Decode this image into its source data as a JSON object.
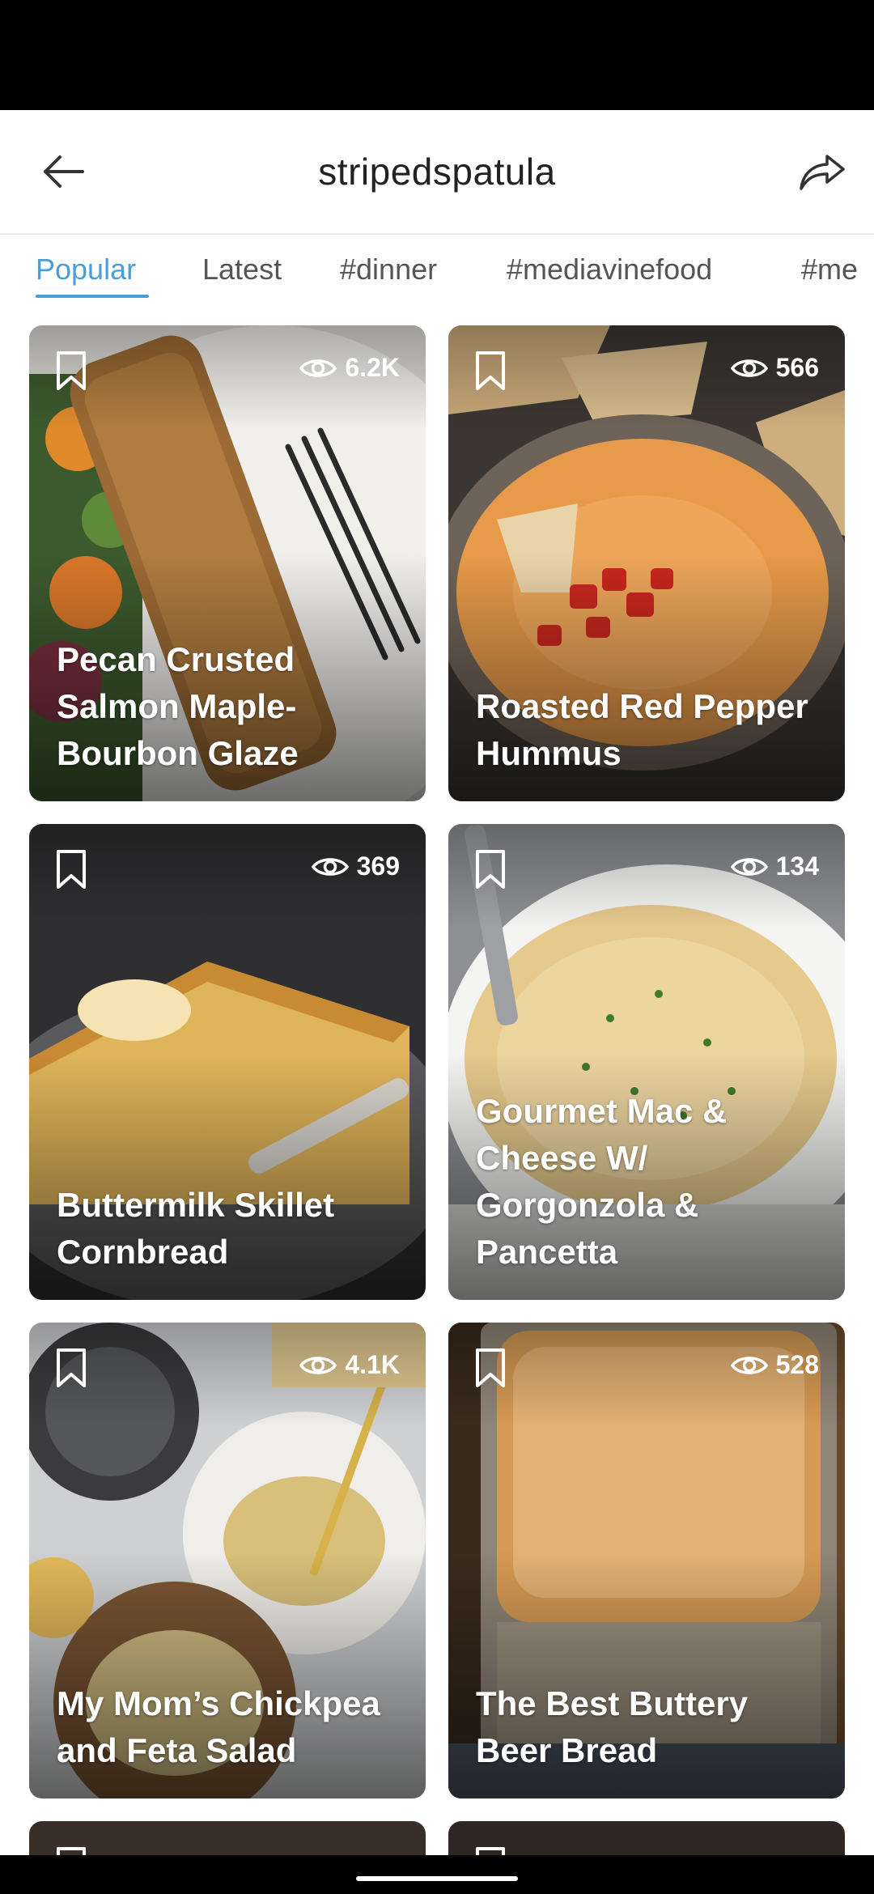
{
  "header": {
    "title": "stripedspatula"
  },
  "tabs": [
    {
      "label": "Popular",
      "active": true
    },
    {
      "label": "Latest",
      "active": false
    },
    {
      "label": "#dinner",
      "active": false
    },
    {
      "label": "#mediavinefood",
      "active": false
    },
    {
      "label": "#me",
      "active": false
    }
  ],
  "accent_color": "#4a9fd8",
  "cards": [
    {
      "title": "Pecan Crusted Salmon Maple-Bourbon Glaze",
      "views": "6.2K"
    },
    {
      "title": "Roasted Red Pepper Hummus",
      "views": "566"
    },
    {
      "title": "Buttermilk Skillet Cornbread",
      "views": "369"
    },
    {
      "title": "Gourmet Mac & Cheese W/ Gorgonzola & Pancetta",
      "views": "134"
    },
    {
      "title": "My Mom’s Chickpea and Feta Salad",
      "views": "4.1K"
    },
    {
      "title": "The Best Buttery Beer Bread",
      "views": "528"
    }
  ],
  "icons": {
    "back": "arrow-left-icon",
    "share": "share-arrow-icon",
    "bookmark": "bookmark-icon",
    "views": "eye-icon"
  }
}
